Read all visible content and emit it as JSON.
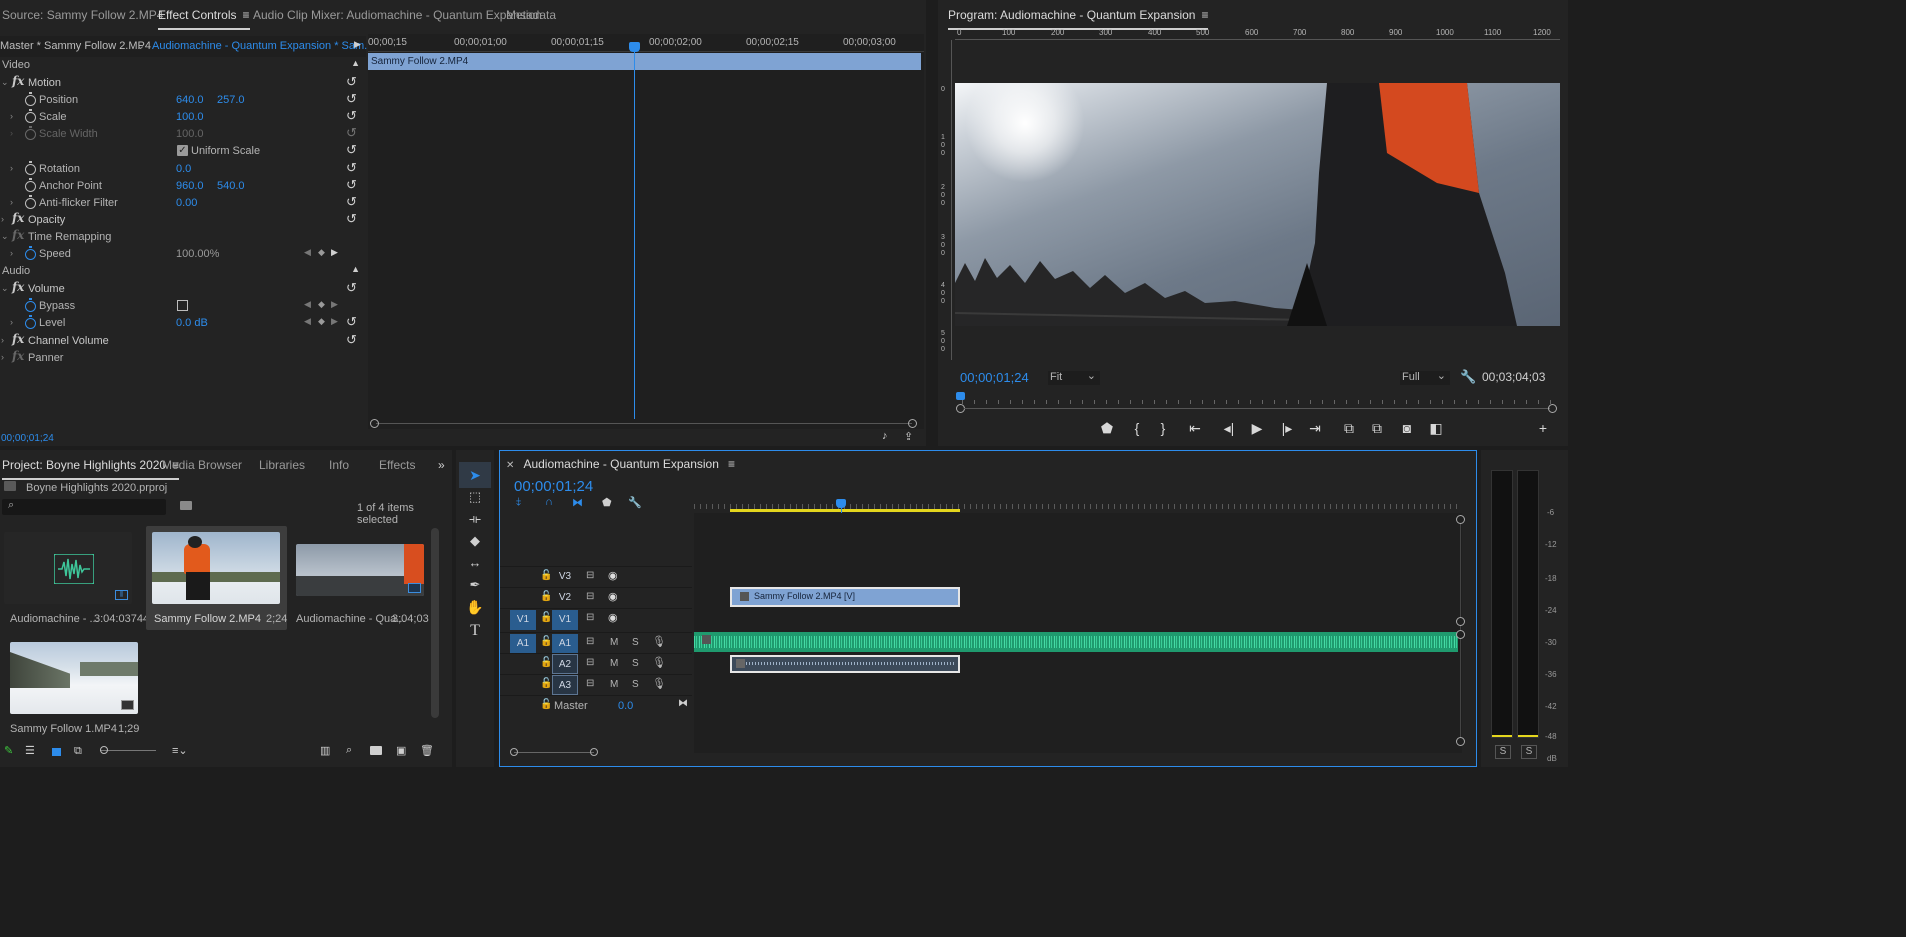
{
  "effect_controls": {
    "tabs": [
      "Source: Sammy Follow 2.MP4",
      "Effect Controls",
      "Audio Clip Mixer: Audiomachine - Quantum Expansion",
      "Metadata"
    ],
    "clip_master": "Master * Sammy Follow 2.MP4",
    "clip_sequence": "Audiomachine - Quantum Expansion * Sam...",
    "ruler_times": [
      "00;00;15",
      "00;00;01;00",
      "00;00;01;15",
      "00;00;02;00",
      "00;00;02;15",
      "00;00;03;00"
    ],
    "clip_bar_label": "Sammy Follow 2.MP4",
    "section_video": "Video",
    "section_audio": "Audio",
    "fx_label": "fx",
    "motion": "Motion",
    "position_label": "Position",
    "position_x": "640.0",
    "position_y": "257.0",
    "scale_label": "Scale",
    "scale_value": "100.0",
    "scale_width_label": "Scale Width",
    "scale_width_value": "100.0",
    "uniform_scale": "Uniform Scale",
    "rotation_label": "Rotation",
    "rotation_value": "0.0",
    "anchor_label": "Anchor Point",
    "anchor_x": "960.0",
    "anchor_y": "540.0",
    "antiflicker_label": "Anti-flicker Filter",
    "antiflicker_value": "0.00",
    "opacity": "Opacity",
    "time_remapping": "Time Remapping",
    "speed_label": "Speed",
    "speed_value": "100.00%",
    "volume": "Volume",
    "bypass_label": "Bypass",
    "level_label": "Level",
    "level_value": "0.0 dB",
    "channel_volume": "Channel Volume",
    "panner": "Panner",
    "timecode": "00;00;01;24"
  },
  "program": {
    "title": "Program: Audiomachine - Quantum Expansion",
    "ruler_labels": [
      "0",
      "100",
      "200",
      "300",
      "400",
      "500",
      "600",
      "700",
      "800",
      "900",
      "1000",
      "1100",
      "1200"
    ],
    "side_ruler": [
      "0",
      "1 0 0",
      "2 0 0",
      "3 0 0",
      "4 0 0",
      "5 0 0",
      "6 0 0"
    ],
    "timecode": "00;00;01;24",
    "fit": "Fit",
    "quality": "Full",
    "duration": "00;03;04;03",
    "playhead_fraction": 0.0
  },
  "project": {
    "tabs": [
      "Project: Boyne Highlights 2020",
      "Media Browser",
      "Libraries",
      "Info",
      "Effects"
    ],
    "file": "Boyne Highlights 2020.prproj",
    "selection": "1 of 4 items selected",
    "items": [
      {
        "name": "Audiomachine - ...",
        "duration": "3:04:03744"
      },
      {
        "name": "Sammy Follow 2.MP4",
        "duration": "2;24"
      },
      {
        "name": "Audiomachine - Qua...",
        "duration": "3;04;03"
      },
      {
        "name": "Sammy Follow 1.MP4",
        "duration": "1;29"
      }
    ]
  },
  "timeline": {
    "title": "Audiomachine - Quantum Expansion",
    "timecode": "00;00;01;24",
    "video_tracks": [
      {
        "label": "V3",
        "src": ""
      },
      {
        "label": "V2",
        "src": ""
      },
      {
        "label": "V1",
        "src": "V1"
      }
    ],
    "audio_tracks": [
      {
        "label": "A1",
        "src": "A1"
      },
      {
        "label": "A2",
        "src": ""
      },
      {
        "label": "A3",
        "src": ""
      }
    ],
    "mute": "M",
    "solo": "S",
    "master_label": "Master",
    "master_value": "0.0",
    "video_clip": "Sammy Follow 2.MP4 [V]"
  },
  "meter": {
    "scale": [
      "-6",
      "-12",
      "-18",
      "-24",
      "-30",
      "-36",
      "-42",
      "-48",
      "dB"
    ],
    "solo_left": "S",
    "solo_right": "S"
  },
  "colors": {
    "accent": "#2d8ceb",
    "clip_video": "#7fa3d3",
    "clip_audio": "#1f9a6e",
    "playhead": "#2d8ceb",
    "work_area": "#e4d61d"
  }
}
